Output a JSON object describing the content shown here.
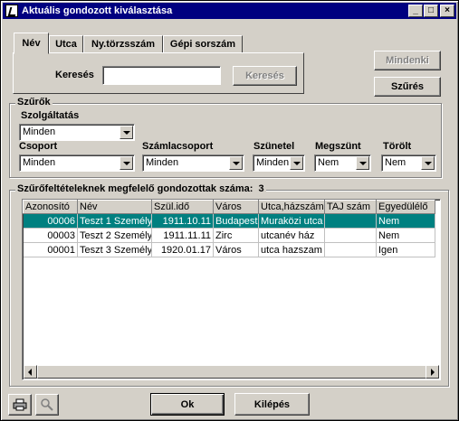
{
  "window": {
    "title": "Aktuális gondozott kiválasztása"
  },
  "tabs": [
    {
      "label": "Név",
      "active": true
    },
    {
      "label": "Utca",
      "active": false
    },
    {
      "label": "Ny.törzsszám",
      "active": false
    },
    {
      "label": "Gépi sorszám",
      "active": false
    }
  ],
  "search": {
    "label": "Keresés",
    "value": "",
    "button": "Keresés"
  },
  "buttons": {
    "mindenki": "Mindenki",
    "szures": "Szűrés",
    "ok": "Ok",
    "kilepes": "Kilépés"
  },
  "filters": {
    "title": "Szűrők",
    "szolgaltatas": {
      "label": "Szolgáltatás",
      "value": "Minden"
    },
    "csoport": {
      "label": "Csoport",
      "value": "Minden"
    },
    "szamlacsoport": {
      "label": "Számlacsoport",
      "value": "Minden"
    },
    "szunetel": {
      "label": "Szünetel",
      "value": "Minden"
    },
    "megszunt": {
      "label": "Megszünt",
      "value": "Nem"
    },
    "torolt": {
      "label": "Törölt",
      "value": "Nem"
    }
  },
  "results": {
    "title": "Szűrőfeltételeknek megfelelő gondozottak száma:",
    "count": "3",
    "columns": [
      "Azonosító",
      "Név",
      "Szül.idő",
      "Város",
      "Utca,házszám",
      "TAJ szám",
      "Egyedülélő"
    ],
    "rows": [
      [
        "00006",
        "Teszt 1 Személy",
        "1911.10.11",
        "Budapest",
        "Muraközi utca",
        "",
        "Nem"
      ],
      [
        "00003",
        "Teszt 2 Személy",
        "1911.11.11",
        "Zirc",
        "utcanév  ház",
        "",
        "Nem"
      ],
      [
        "00001",
        "Teszt 3 Személy",
        "1920.01.17",
        "Város",
        "utca hazszam",
        "",
        "Igen"
      ]
    ],
    "selected_row": 0
  },
  "icons": {
    "title": "app-icon",
    "print": "printer-icon",
    "preview": "magnifier-icon"
  }
}
